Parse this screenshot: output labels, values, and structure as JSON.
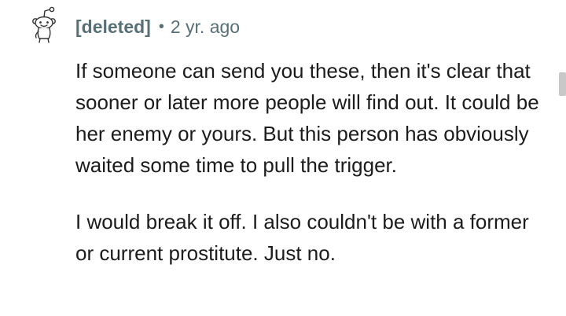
{
  "comment": {
    "author": "[deleted]",
    "separator": "•",
    "age": "2 yr. ago",
    "avatar_icon": "snoo-avatar-icon",
    "paragraphs": [
      "If someone can send you these, then it's clear that sooner or later more people will find out. It could be her enemy or yours. But this person has obviously waited some time to pull the trigger.",
      "I would break it off. I also couldn't be with a former or current prostitute. Just no."
    ]
  }
}
